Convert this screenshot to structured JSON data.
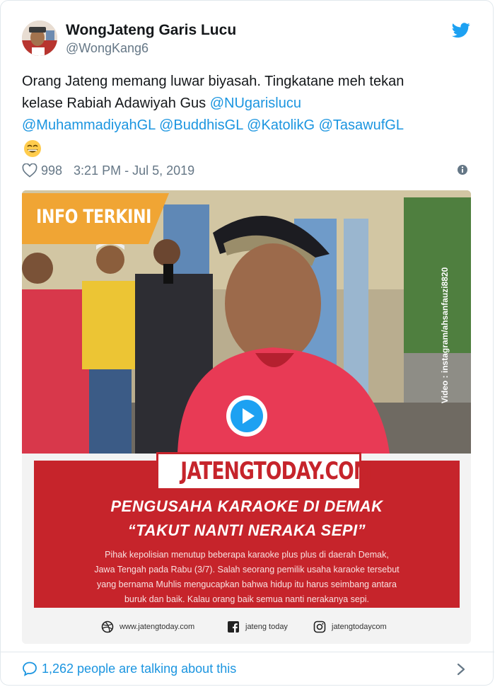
{
  "author": {
    "name": "WongJateng Garis Lucu",
    "handle": "@WongKang6"
  },
  "tweet": {
    "text_line1": "Orang Jateng memang luwar biyasah. Tingkatane meh tekan",
    "text_line2_prefix": "kelase Rabiah Adawiyah Gus ",
    "mentions": [
      "@NUgarislucu",
      "@MuhammadiyahGL",
      "@BuddhisGL",
      "@KatolikG",
      "@TasawufGL"
    ],
    "emoji": "grinning-face-smiling-eyes"
  },
  "meta": {
    "likes": "998",
    "timestamp": "3:21 PM - Jul 5, 2019"
  },
  "media": {
    "badge": "INFO TERKINI",
    "watermark": "Video : instagram/ahsanfauzi8820",
    "logo": "JATENGTODAY.COM",
    "headline1": "PENGUSAHA KARAOKE DI DEMAK",
    "headline2": "“TAKUT NANTI NERAKA SEPI”",
    "body": [
      "Pihak kepolisian menutup beberapa karaoke plus plus di daerah Demak,",
      "Jawa Tengah pada Rabu (3/7). Salah seorang pemilik usaha karaoke tersebut",
      "yang bernama Muhlis mengucapkan bahwa hidup itu harus seimbang antara",
      "buruk dan baik. Kalau orang baik semua nanti nerakanya sepi."
    ],
    "footer": {
      "website": "www.jatengtoday.com",
      "facebook": "jateng today",
      "instagram": "jatengtodaycom"
    }
  },
  "conversation": {
    "label": "1,262 people are talking about this"
  },
  "colors": {
    "link": "#1b95e0",
    "badge": "#f0a534",
    "panel_red": "#c6242b",
    "play": "#1da1f2"
  }
}
